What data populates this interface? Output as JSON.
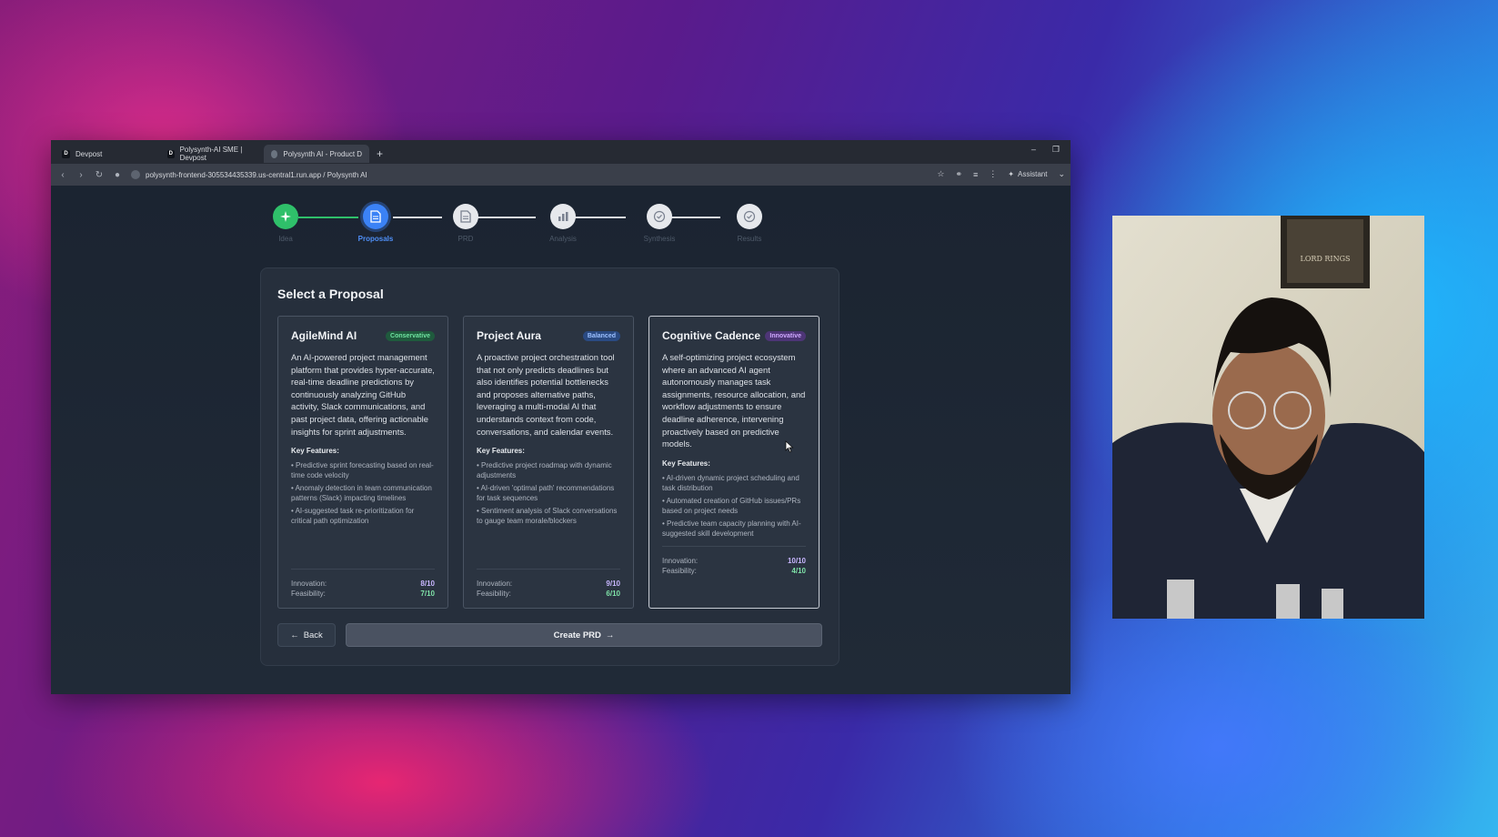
{
  "browser": {
    "tabs": [
      {
        "label": "Devpost",
        "favicon": "D",
        "active": false
      },
      {
        "label": "Polysynth-AI SME | Devpost",
        "favicon": "D",
        "active": false
      },
      {
        "label": "Polysynth AI - Product Design",
        "favicon": "globe-icon",
        "active": true
      }
    ],
    "new_tab": "+",
    "url": "polysynth-frontend-305534435339.us-central1.run.app / Polysynth AI",
    "assistant_label": "Assistant"
  },
  "stepper": {
    "steps": [
      {
        "label": "Idea",
        "state": "done"
      },
      {
        "label": "Proposals",
        "state": "current"
      },
      {
        "label": "PRD",
        "state": "pending"
      },
      {
        "label": "Analysis",
        "state": "pending"
      },
      {
        "label": "Synthesis",
        "state": "pending"
      },
      {
        "label": "Results",
        "state": "pending"
      }
    ]
  },
  "panel": {
    "title": "Select a Proposal",
    "proposals": [
      {
        "title": "AgileMind AI",
        "badge": "Conservative",
        "description": "An AI-powered project management platform that provides hyper-accurate, real-time deadline predictions by continuously analyzing GitHub activity, Slack communications, and past project data, offering actionable insights for sprint adjustments.",
        "key_features_label": "Key Features:",
        "features": [
          "• Predictive sprint forecasting based on real-time code velocity",
          "• Anomaly detection in team communication patterns (Slack) impacting timelines",
          "• AI-suggested task re-prioritization for critical path optimization"
        ],
        "innovation_label": "Innovation:",
        "innovation": "8/10",
        "feasibility_label": "Feasibility:",
        "feasibility": "7/10"
      },
      {
        "title": "Project Aura",
        "badge": "Balanced",
        "description": "A proactive project orchestration tool that not only predicts deadlines but also identifies potential bottlenecks and proposes alternative paths, leveraging a multi-modal AI that understands context from code, conversations, and calendar events.",
        "key_features_label": "Key Features:",
        "features": [
          "• Predictive project roadmap with dynamic adjustments",
          "• AI-driven 'optimal path' recommendations for task sequences",
          "• Sentiment analysis of Slack conversations to gauge team morale/blockers"
        ],
        "innovation_label": "Innovation:",
        "innovation": "9/10",
        "feasibility_label": "Feasibility:",
        "feasibility": "6/10"
      },
      {
        "title": "Cognitive Cadence",
        "badge": "Innovative",
        "description": "A self-optimizing project ecosystem where an advanced AI agent autonomously manages task assignments, resource allocation, and workflow adjustments to ensure deadline adherence, intervening proactively based on predictive models.",
        "key_features_label": "Key Features:",
        "features": [
          "• AI-driven dynamic project scheduling and task distribution",
          "• Automated creation of GitHub issues/PRs based on project needs",
          "• Predictive team capacity planning with AI-suggested skill development"
        ],
        "innovation_label": "Innovation:",
        "innovation": "10/10",
        "feasibility_label": "Feasibility:",
        "feasibility": "4/10"
      }
    ],
    "back_label": "Back",
    "create_label": "Create PRD"
  },
  "colors": {
    "step_done": "#2fc06a",
    "step_current": "#3b82f6",
    "panel_bg": "#262f3c",
    "badge_conservative": "#6fe3a1",
    "badge_balanced": "#9cc0ff",
    "badge_innovative": "#cfa9ff"
  }
}
